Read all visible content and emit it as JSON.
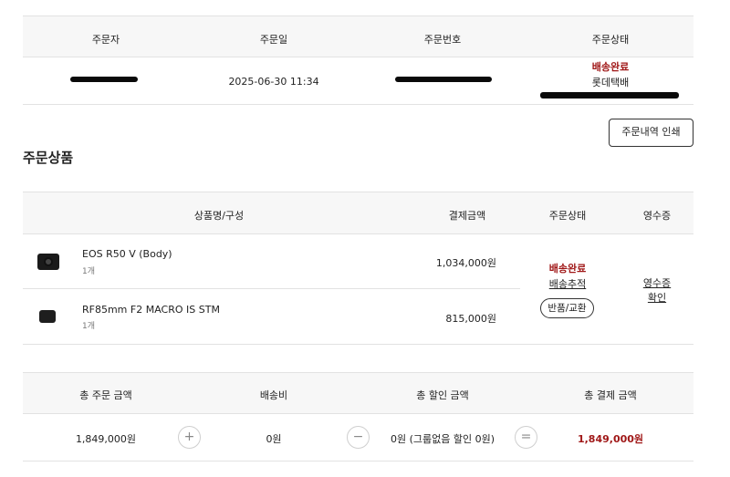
{
  "order_info": {
    "headers": [
      "주문자",
      "주문일",
      "주문번호",
      "주문상태"
    ],
    "order_date": "2025-06-30 11:34",
    "status": "배송완료",
    "courier": "롯데택배"
  },
  "print_button": "주문내역 인쇄",
  "section_title": "주문상품",
  "products_table": {
    "headers": {
      "product": "상품명/구성",
      "amount": "결제금액",
      "status": "주문상태",
      "receipt": "영수증"
    },
    "items": [
      {
        "name": "EOS R50 V (Body)",
        "qty": "1개",
        "price": "1,034,000원",
        "icon": "camera-body-icon"
      },
      {
        "name": "RF85mm F2 MACRO IS STM",
        "qty": "1개",
        "price": "815,000원",
        "icon": "camera-lens-icon"
      }
    ],
    "status": "배송완료",
    "tracking_link": "배송추적",
    "return_button": "반품/교환",
    "receipt_link_line1": "영수증",
    "receipt_link_line2": "확인"
  },
  "summary": {
    "headers": {
      "order_total": "총 주문 금액",
      "shipping": "배송비",
      "discount": "총 할인 금액",
      "payment": "총 결제 금액"
    },
    "order_total": "1,849,000원",
    "shipping": "0원",
    "discount": "0원 (그룹없음 할인 0원)",
    "payment": "1,849,000원",
    "ops": {
      "plus": "+",
      "minus": "−",
      "equals": "="
    }
  },
  "colors": {
    "status_red": "#a01818",
    "header_bg": "#f7f7f7",
    "border": "#e2e2e2"
  }
}
